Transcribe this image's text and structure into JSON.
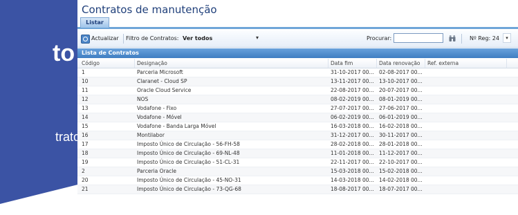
{
  "promo": {
    "title": "to",
    "subtitle": "trato"
  },
  "app": {
    "title": "Contratos de manutenção",
    "tabs": [
      {
        "label": "Listar"
      }
    ],
    "toolbar": {
      "refresh_label": "Actualizar",
      "filter_label": "Filtro de Contratos:",
      "filter_value": "Ver todos",
      "search_label": "Procurar:",
      "search_value": "",
      "nreg_label": "Nº Reg: 24"
    },
    "list_title": "Lista de Contratos",
    "columns": [
      "Código",
      "Designação",
      "Data fim",
      "Data renovação",
      "Ref. externa"
    ],
    "rows": [
      {
        "code": "1",
        "desig": "Parceria Microsoft",
        "fim": "31-10-2017 00...",
        "ren": "02-08-2017 00..."
      },
      {
        "code": "10",
        "desig": "Claranet - Cloud SP",
        "fim": "13-11-2017 00...",
        "ren": "13-10-2017 00..."
      },
      {
        "code": "11",
        "desig": "Oracle Cloud Service",
        "fim": "22-08-2017 00...",
        "ren": "20-07-2017 00..."
      },
      {
        "code": "12",
        "desig": "NOS",
        "fim": "08-02-2019 00...",
        "ren": "08-01-2019 00..."
      },
      {
        "code": "13",
        "desig": "Vodafone - Fixo",
        "fim": "27-07-2017 00...",
        "ren": "27-06-2017 00..."
      },
      {
        "code": "14",
        "desig": "Vodafone - Móvel",
        "fim": "06-02-2019 00...",
        "ren": "06-01-2019 00..."
      },
      {
        "code": "15",
        "desig": "Vodafone - Banda Larga Móvel",
        "fim": "16-03-2018 00...",
        "ren": "16-02-2018 00..."
      },
      {
        "code": "16",
        "desig": "Montilabor",
        "fim": "31-12-2017 00...",
        "ren": "30-11-2017 00..."
      },
      {
        "code": "17",
        "desig": "Imposto Único de Circulação - 56-FH-58",
        "fim": "28-02-2018 00...",
        "ren": "28-01-2018 00..."
      },
      {
        "code": "18",
        "desig": "Imposto Único de Circulação - 69-NL-48",
        "fim": "11-01-2018 00...",
        "ren": "11-12-2017 00..."
      },
      {
        "code": "19",
        "desig": "Imposto Único de Circulação - 51-CL-31",
        "fim": "22-11-2017 00...",
        "ren": "22-10-2017 00..."
      },
      {
        "code": "2",
        "desig": "Parceria Oracle",
        "fim": "15-03-2018 00...",
        "ren": "15-02-2018 00..."
      },
      {
        "code": "20",
        "desig": "Imposto Único de Circulação - 45-NO-31",
        "fim": "14-03-2018 00...",
        "ren": "14-02-2018 00..."
      },
      {
        "code": "21",
        "desig": "Imposto Único de Circulação - 73-QG-68",
        "fim": "18-08-2017 00...",
        "ren": "18-07-2017 00..."
      }
    ]
  },
  "colors": {
    "promo_blue": "#3b53a4",
    "header_blue": "#4a88c8",
    "title_blue": "#1f3f7a"
  }
}
